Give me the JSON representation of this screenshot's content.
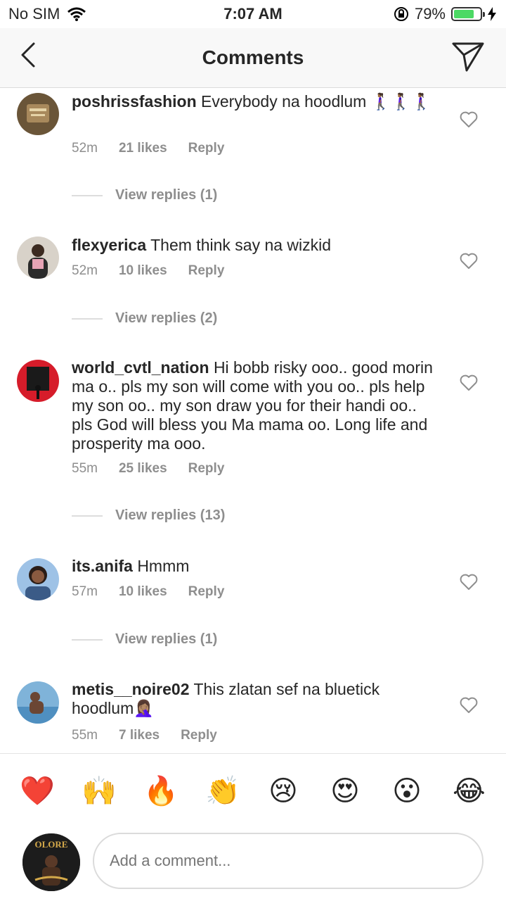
{
  "status_bar": {
    "carrier": "No SIM",
    "time": "7:07 AM",
    "battery": "79%",
    "battery_level": 0.79
  },
  "header": {
    "title": "Comments",
    "back_icon": "chevron-left-icon",
    "send_icon": "paper-plane-icon"
  },
  "comments": [
    {
      "username": "poshrissfashion",
      "text": "Everybody na hoodlum 🚶🏾‍♀️🚶🏾‍♀️🚶🏾‍♀️",
      "time": "52m",
      "likes": "21 likes",
      "reply": "Reply",
      "view_replies": "View replies (1)",
      "avatar_color": "#8a6f48"
    },
    {
      "username": "flexyerica",
      "text": "Them think say na wizkid",
      "time": "52m",
      "likes": "10 likes",
      "reply": "Reply",
      "view_replies": "View replies (2)",
      "avatar_color": "#b9b2a8"
    },
    {
      "username": "world_cvtl_nation",
      "text": "Hi bobb risky ooo.. good morin ma o.. pls my son will come with you oo.. pls help my son oo.. my son draw you for their handi oo.. pls God will bless you Ma mama oo. Long life and prosperity ma ooo.",
      "time": "55m",
      "likes": "25 likes",
      "reply": "Reply",
      "view_replies": "View replies (13)",
      "avatar_color": "#d61c2a"
    },
    {
      "username": "its.anifa",
      "text": "Hmmm",
      "time": "57m",
      "likes": "10 likes",
      "reply": "Reply",
      "view_replies": "View replies (1)",
      "avatar_color": "#3b5b87"
    },
    {
      "username": "metis__noire02",
      "text": "This zlatan sef na bluetick hoodlum🤦🏽‍♀️",
      "time": "55m",
      "likes": "7 likes",
      "reply": "Reply",
      "avatar_color": "#7fb3d9"
    }
  ],
  "emoji_bar": [
    "❤️",
    "🙌",
    "🔥",
    "👏",
    "😢",
    "😍",
    "😮",
    "😂"
  ],
  "compose": {
    "placeholder": "Add a comment...",
    "avatar_text": "OLORE"
  },
  "colors": {
    "text": "#262626",
    "muted": "#8e8e8e",
    "battery_green": "#4cd964"
  }
}
